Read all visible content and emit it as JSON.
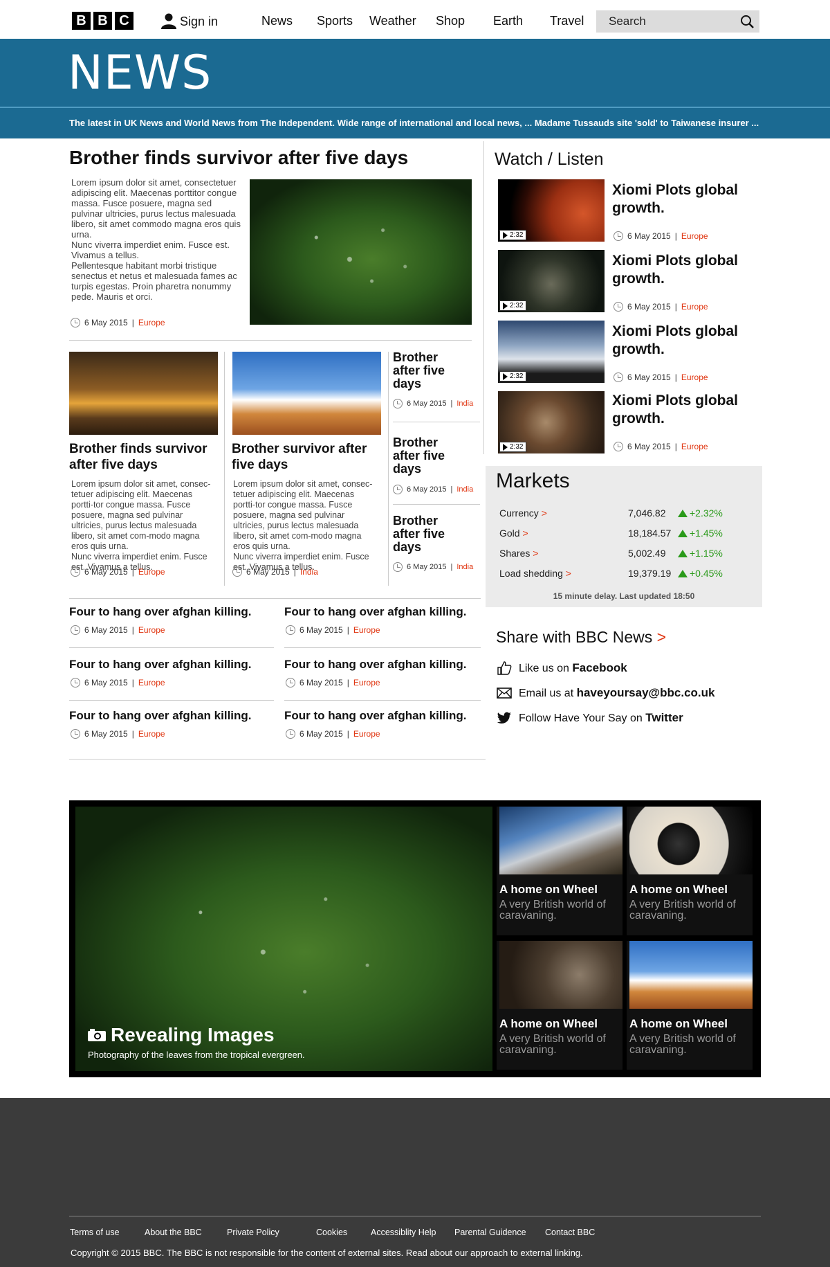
{
  "header": {
    "logo_letters": [
      "B",
      "B",
      "C"
    ],
    "signin_label": "Sign in",
    "nav": [
      "News",
      "Sports",
      "Weather",
      "Shop",
      "Earth",
      "Travel"
    ],
    "search_placeholder": "Search"
  },
  "banner": {
    "title": "NEWS",
    "ticker": "The latest in UK News and World News from The Independent. Wide range of international and local news, ... Madame Tussauds site 'sold' to Taiwanese insurer ..."
  },
  "lead": {
    "headline": "Brother finds survivor after five days",
    "body": "Lorem ipsum dolor sit amet, consectetuer adipiscing elit. Maecenas porttitor congue massa. Fusce posuere, magna sed pulvinar ultricies, purus lectus malesuada libero, sit amet commodo magna eros quis urna.\nNunc viverra imperdiet enim. Fusce est. Vivamus a tellus.\nPellentesque habitant morbi tristique senectus et netus et malesuada fames ac turpis egestas. Proin pharetra nonummy pede. Mauris et orci.",
    "date": "6 May 2015",
    "tag": "Europe"
  },
  "secondary": [
    {
      "headline": "Brother finds survivor after five days",
      "body": "Lorem ipsum dolor sit amet, consec-tetuer adipiscing elit. Maecenas portti-tor congue massa. Fusce posuere, magna sed pulvinar ultricies, purus lectus malesuada libero, sit amet com-modo magna eros quis urna.\nNunc viverra imperdiet enim. Fusce est. Vivamus a tellus.",
      "date": "6 May 2015",
      "tag": "Europe"
    },
    {
      "headline": "Brother survivor after five days",
      "body": "Lorem ipsum dolor sit amet, consec-tetuer adipiscing elit. Maecenas portti-tor congue massa. Fusce posuere, magna sed pulvinar ultricies, purus lectus malesuada libero, sit amet com-modo magna eros quis urna.\nNunc viverra imperdiet enim. Fusce est. Vivamus a tellus.",
      "date": "6 May 2015",
      "tag": "India"
    }
  ],
  "mini_stories": [
    {
      "headline": "Brother after five days",
      "date": "6 May 2015",
      "tag": "India"
    },
    {
      "headline": "Brother after five days",
      "date": "6 May 2015",
      "tag": "India"
    },
    {
      "headline": "Brother after five days",
      "date": "6 May 2015",
      "tag": "India"
    }
  ],
  "short_stories": [
    {
      "headline": "Four to hang over afghan killing.",
      "date": "6 May 2015",
      "tag": "Europe"
    },
    {
      "headline": "Four to hang over afghan killing.",
      "date": "6 May 2015",
      "tag": "Europe"
    },
    {
      "headline": "Four to hang over afghan killing.",
      "date": "6 May 2015",
      "tag": "Europe"
    },
    {
      "headline": "Four to hang over afghan killing.",
      "date": "6 May 2015",
      "tag": "Europe"
    },
    {
      "headline": "Four to hang over afghan killing.",
      "date": "6 May 2015",
      "tag": "Europe"
    },
    {
      "headline": "Four to hang over afghan killing.",
      "date": "6 May 2015",
      "tag": "Europe"
    }
  ],
  "watch": {
    "title": "Watch / Listen",
    "items": [
      {
        "headline": "Xiomi Plots global growth.",
        "duration": "2:32",
        "date": "6 May 2015",
        "tag": "Europe"
      },
      {
        "headline": "Xiomi Plots global growth.",
        "duration": "2:32",
        "date": "6 May 2015",
        "tag": "Europe"
      },
      {
        "headline": "Xiomi Plots global growth.",
        "duration": "2:32",
        "date": "6 May 2015",
        "tag": "Europe"
      },
      {
        "headline": "Xiomi Plots global growth.",
        "duration": "2:32",
        "date": "6 May 2015",
        "tag": "Europe"
      }
    ]
  },
  "markets": {
    "title": "Markets",
    "rows": [
      {
        "label": "Currency",
        "value": "7,046.82",
        "change": "+2.32%"
      },
      {
        "label": "Gold",
        "value": "18,184.57",
        "change": "+1.45%"
      },
      {
        "label": "Shares",
        "value": "5,002.49",
        "change": "+1.15%"
      },
      {
        "label": "Load shedding",
        "value": "19,379.19",
        "change": "+0.45%"
      }
    ],
    "arrow": ">",
    "note": "15 minute delay. Last updated 18:50",
    "up_color": "#2a9a1a"
  },
  "share": {
    "title": "Share with BBC News",
    "arrow": ">",
    "facebook_prefix": "Like us on",
    "facebook_name": "Facebook",
    "email_prefix": "Email us at",
    "email_address": "haveyoursay@bbc.co.uk",
    "twitter_prefix": "Follow Have Your Say on",
    "twitter_name": "Twitter"
  },
  "gallery": {
    "main_title": "Revealing Images",
    "main_caption": "Photography of the leaves from the tropical evergreen.",
    "tiles": [
      {
        "title": "A home on Wheel",
        "sub": "A very British world of caravaning."
      },
      {
        "title": "A home on Wheel",
        "sub": "A very British world of caravaning."
      },
      {
        "title": "A home on Wheel",
        "sub": "A very British world of caravaning."
      },
      {
        "title": "A home on Wheel",
        "sub": "A very British world of caravaning."
      }
    ]
  },
  "footer": {
    "links": [
      "Terms of use",
      "About the BBC",
      "Private Policy",
      "Cookies",
      "Accessiblity Help",
      "Parental Guidence",
      "Contact BBC"
    ],
    "copyright": "Copyright © 2015 BBC. The BBC is not responsible for the content of external sites. Read about our approach to external linking."
  },
  "colors": {
    "brand_blue": "#1b6a92",
    "tag_red": "#e0340f",
    "footer_bg": "#3b3b3b"
  }
}
